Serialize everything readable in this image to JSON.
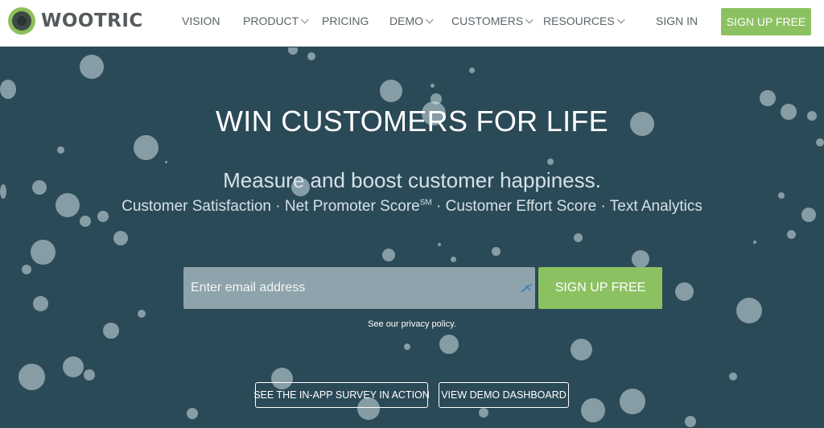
{
  "header": {
    "logo_text": "WOOTRIC",
    "nav": [
      {
        "label": "VISION",
        "dropdown": false
      },
      {
        "label": "PRODUCT",
        "dropdown": true
      },
      {
        "label": "PRICING",
        "dropdown": false
      },
      {
        "label": "DEMO",
        "dropdown": true
      },
      {
        "label": "CUSTOMERS",
        "dropdown": true
      },
      {
        "label": "RESOURCES",
        "dropdown": true
      }
    ],
    "sign_in": "SIGN IN",
    "signup": "SIGN UP FREE"
  },
  "hero": {
    "headline": "WIN CUSTOMERS FOR LIFE",
    "subhead": "Measure and boost customer happiness.",
    "features_part1": "Customer Satisfaction · Net Promoter Score",
    "features_sup": "SM",
    "features_part2": " · Customer Effort Score · Text Analytics",
    "email_placeholder": "Enter email address",
    "signup_button": "SIGN UP FREE",
    "privacy": "See our privacy policy.",
    "survey_button": "SEE THE IN-APP SURVEY IN ACTION",
    "dashboard_button": "VIEW DEMO DASHBOARD"
  },
  "colors": {
    "hero_bg": "#2b4a57",
    "accent_green": "#8cc162",
    "input_bg": "#8ea3ac"
  }
}
